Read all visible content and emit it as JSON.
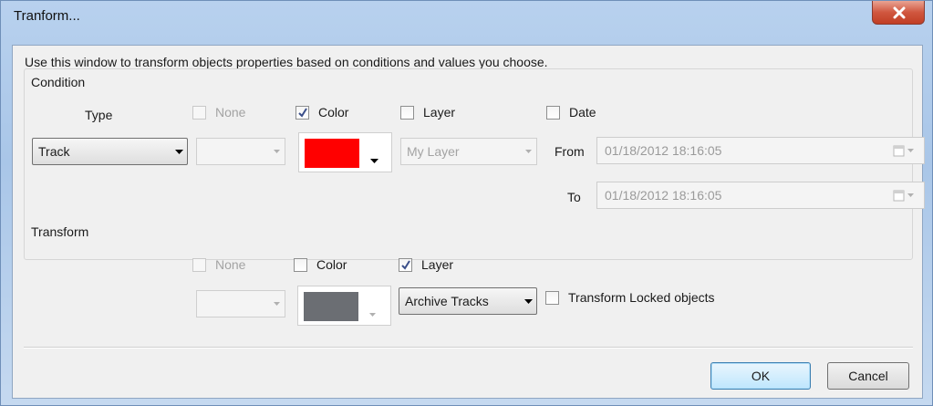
{
  "window": {
    "title": "Tranform..."
  },
  "hint": "Use this window to transform objects properties based on conditions and values you choose.",
  "condition": {
    "group_label": "Condition",
    "type_label": "Type",
    "type_value": "Track",
    "none_label": "None",
    "none_checked": false,
    "color_label": "Color",
    "color_checked": true,
    "color_value": "#ff0000",
    "layer_label": "Layer",
    "layer_checked": false,
    "layer_value": "My Layer",
    "date_label": "Date",
    "date_checked": false,
    "from_label": "From",
    "from_value": "01/18/2012 18:16:05",
    "to_label": "To",
    "to_value": "01/18/2012 18:16:05"
  },
  "transform": {
    "group_label": "Transform",
    "none_label": "None",
    "none_checked": false,
    "color_label": "Color",
    "color_checked": false,
    "color_value": "#6b6e73",
    "layer_label": "Layer",
    "layer_checked": true,
    "layer_value": "Archive Tracks",
    "locked_label": "Transform Locked objects",
    "locked_checked": false
  },
  "buttons": {
    "ok": "OK",
    "cancel": "Cancel"
  }
}
